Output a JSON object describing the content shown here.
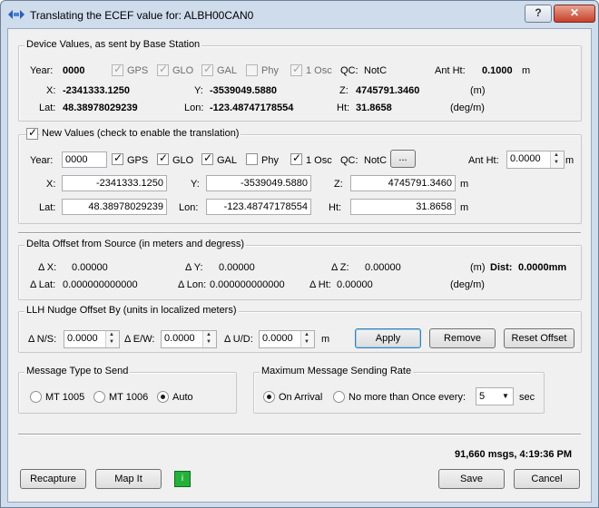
{
  "window": {
    "title": "Translating the ECEF value for: ALBH00CAN0",
    "help_label": "?",
    "close_label": "✕"
  },
  "device": {
    "group_title": "Device Values, as sent by Base Station",
    "year_label": "Year:",
    "year": "0000",
    "flags": {
      "gps": "GPS",
      "glo": "GLO",
      "gal": "GAL",
      "phy": "Phy",
      "osc": "1 Osc"
    },
    "qc_label": "QC:",
    "qc": "NotC",
    "antht_label": "Ant Ht:",
    "antht": "0.1000",
    "antht_unit": "m",
    "x_label": "X:",
    "x": "-2341333.1250",
    "y_label": "Y:",
    "y": "-3539049.5880",
    "z_label": "Z:",
    "z": "4745791.3460",
    "xyz_unit": "(m)",
    "lat_label": "Lat:",
    "lat": "48.38978029239",
    "lon_label": "Lon:",
    "lon": "-123.48747178554",
    "ht_label": "Ht:",
    "ht": "31.8658",
    "llh_unit": "(deg/m)"
  },
  "newvals": {
    "group_title": "New Values (check to enable the translation)",
    "year_label": "Year:",
    "year": "0000",
    "flags": {
      "gps": "GPS",
      "glo": "GLO",
      "gal": "GAL",
      "phy": "Phy",
      "osc": "1 Osc"
    },
    "qc_label": "QC:",
    "qc": "NotC",
    "qc_button": "...",
    "antht_label": "Ant Ht:",
    "antht": "0.0000",
    "antht_unit": "m",
    "x_label": "X:",
    "x": "-2341333.1250",
    "y_label": "Y:",
    "y": "-3539049.5880",
    "z_label": "Z:",
    "z": "4745791.3460",
    "m_unit": "m",
    "lat_label": "Lat:",
    "lat": "48.38978029239",
    "lon_label": "Lon:",
    "lon": "-123.48747178554",
    "ht_label": "Ht:",
    "ht": "31.8658"
  },
  "delta": {
    "group_title": "Delta Offset from Source (in meters and degress)",
    "dx_label": "Δ X:",
    "dx": "0.00000",
    "dy_label": "Δ Y:",
    "dy": "0.00000",
    "dz_label": "Δ Z:",
    "dz": "0.00000",
    "m_unit": "(m)",
    "dist_label": "Dist:",
    "dist": "0.0000mm",
    "dlat_label": "Δ Lat:",
    "dlat": "0.000000000000",
    "dlon_label": "Δ Lon:",
    "dlon": "0.000000000000",
    "dht_label": "Δ Ht:",
    "dht": "0.00000",
    "deg_unit": "(deg/m)"
  },
  "nudge": {
    "group_title": "LLH Nudge Offset By   (units in localized meters)",
    "ns_label": "Δ N/S:",
    "ns": "0.0000",
    "ew_label": "Δ E/W:",
    "ew": "0.0000",
    "ud_label": "Δ U/D:",
    "ud": "0.0000",
    "m_unit": "m",
    "apply": "Apply",
    "remove": "Remove",
    "reset": "Reset Offset"
  },
  "msgtype": {
    "group_title": "Message Type to Send",
    "mt1005": "MT 1005",
    "mt1006": "MT 1006",
    "auto": "Auto"
  },
  "maxrate": {
    "group_title": "Maximum Message Sending Rate",
    "on_arrival": "On Arrival",
    "no_more": "No more than Once every:",
    "interval": "5",
    "unit": "sec"
  },
  "status": {
    "msgs": "91,660 msgs,  4:19:36 PM"
  },
  "footer": {
    "recapture": "Recapture",
    "mapit": "Map It",
    "info": "i",
    "save": "Save",
    "cancel": "Cancel"
  }
}
